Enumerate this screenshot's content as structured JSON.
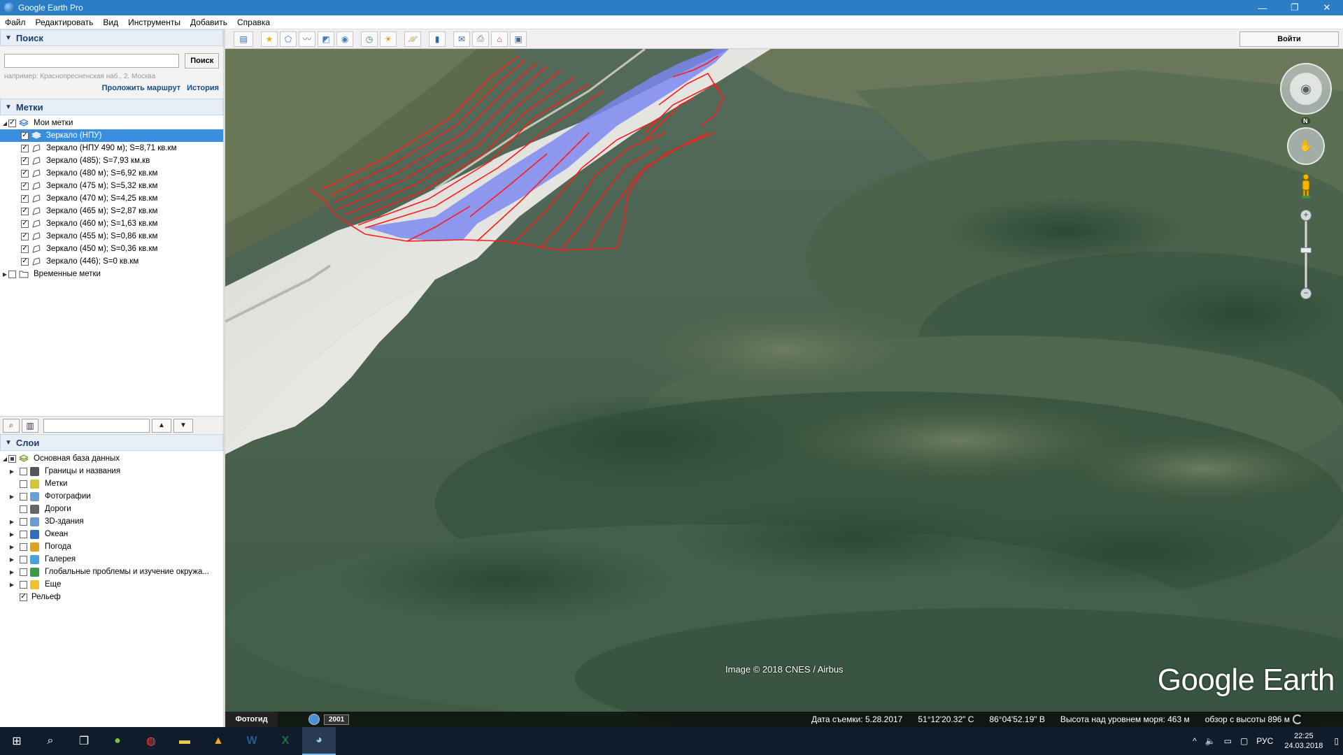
{
  "window": {
    "title": "Google Earth Pro",
    "minimize": "—",
    "maximize": "❐",
    "close": "✕"
  },
  "menu": [
    "Файл",
    "Редактировать",
    "Вид",
    "Инструменты",
    "Добавить",
    "Справка"
  ],
  "search": {
    "header": "Поиск",
    "input_value": "",
    "button": "Поиск",
    "hint": "например: Краснопресненская наб., 2, Москва",
    "route_link": "Проложить маршрут",
    "history_link": "История"
  },
  "places": {
    "header": "Метки",
    "root": "Мои метки",
    "items": [
      {
        "label": "Зеркало (НПУ)",
        "checked": true,
        "selected": true
      },
      {
        "label": "Зеркало (НПУ 490 м); S=8,71 кв.км",
        "checked": true
      },
      {
        "label": "Зеркало (485); S=7,93 км.кв",
        "checked": true
      },
      {
        "label": "Зеркало (480 м); S=6,92 кв.км",
        "checked": true
      },
      {
        "label": "Зеркало (475 м); S=5,32 кв.км",
        "checked": true
      },
      {
        "label": "Зеркало (470 м); S=4,25 кв.км",
        "checked": true
      },
      {
        "label": "Зеркало (465 м); S=2,87 кв.км",
        "checked": true
      },
      {
        "label": "Зеркало (460 м); S=1,63 кв.км",
        "checked": true
      },
      {
        "label": "Зеркало (455 м); S=0,86 кв.км",
        "checked": true
      },
      {
        "label": "Зеркало (450 м); S=0,36 кв.км",
        "checked": true
      },
      {
        "label": "Зеркало (446); S=0 кв.км",
        "checked": true
      }
    ],
    "temp": "Временные метки"
  },
  "layers": {
    "header": "Слои",
    "root": "Основная база данных",
    "items": [
      {
        "label": "Границы и названия",
        "icon": "flag-icon",
        "color": "#555555"
      },
      {
        "label": "Метки",
        "icon": "placemark-icon",
        "color": "#d8c23a"
      },
      {
        "label": "Фотографии",
        "icon": "photo-icon",
        "color": "#6aa0d8"
      },
      {
        "label": "Дороги",
        "icon": "road-icon",
        "color": "#666666"
      },
      {
        "label": "3D-здания",
        "icon": "building-icon",
        "color": "#6a9ccf"
      },
      {
        "label": "Океан",
        "icon": "ocean-icon",
        "color": "#2f6fc0"
      },
      {
        "label": "Погода",
        "icon": "weather-icon",
        "color": "#e0a020"
      },
      {
        "label": "Галерея",
        "icon": "gallery-icon",
        "color": "#4aa0e0"
      },
      {
        "label": "Глобальные проблемы и изучение окружа...",
        "icon": "globe-icon",
        "color": "#3a9a4a"
      },
      {
        "label": "Еще",
        "icon": "more-icon",
        "color": "#f0c030"
      }
    ],
    "terrain": "Рельеф"
  },
  "toolbar": {
    "signin": "Войти"
  },
  "map": {
    "credits": "Image © 2018 CNES / Airbus",
    "logo": "Google Earth",
    "north": "N"
  },
  "status": {
    "tour_guide": "Фотогид",
    "year": "2001",
    "date": "Дата съемки: 5.28.2017",
    "lat": "51°12'20.32\" С",
    "lon": "86°04'52.19\" В",
    "elevation": "Высота над уровнем моря:   463 м",
    "eye_alt": "обзор с высоты   896 м"
  },
  "taskbar": {
    "lang": "РУС",
    "time": "22:25",
    "date": "24.03.2018"
  }
}
